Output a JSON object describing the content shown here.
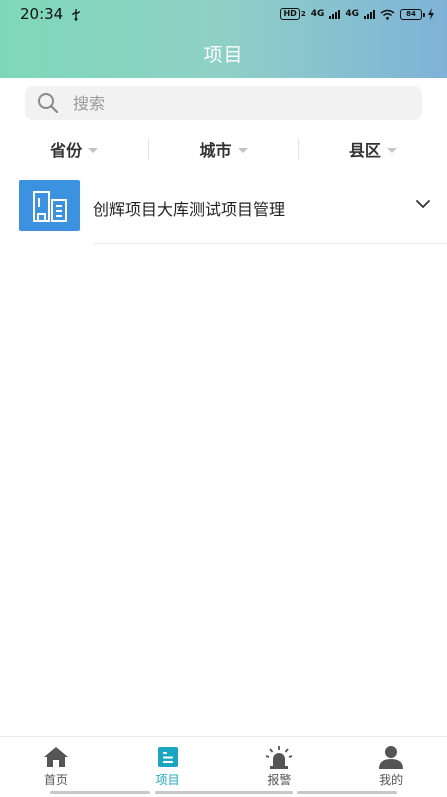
{
  "status_bar": {
    "time": "20:34",
    "usb_icon": "usb-icon",
    "hd_label": "HD",
    "hd_sub": "2",
    "net1": "4G",
    "net2": "4G",
    "battery": "84"
  },
  "header": {
    "title": "项目",
    "gradient": [
      "#7ed8b8",
      "#7fb2d8"
    ]
  },
  "search": {
    "placeholder": "搜索",
    "value": "",
    "icon": "search-icon"
  },
  "filters": [
    {
      "label": "省份"
    },
    {
      "label": "城市"
    },
    {
      "label": "县区"
    }
  ],
  "projects": [
    {
      "title": "创辉项目大库测试项目管理",
      "icon": "building-icon",
      "thumb_color": "#3d92e0"
    }
  ],
  "bottom_nav": {
    "items": [
      {
        "label": "首页",
        "icon": "home-icon",
        "active": false
      },
      {
        "label": "项目",
        "icon": "project-icon",
        "active": true
      },
      {
        "label": "报警",
        "icon": "alarm-icon",
        "active": false
      },
      {
        "label": "我的",
        "icon": "user-icon",
        "active": false
      }
    ],
    "active_color": "#1aa6c0",
    "inactive_color": "#555555"
  }
}
